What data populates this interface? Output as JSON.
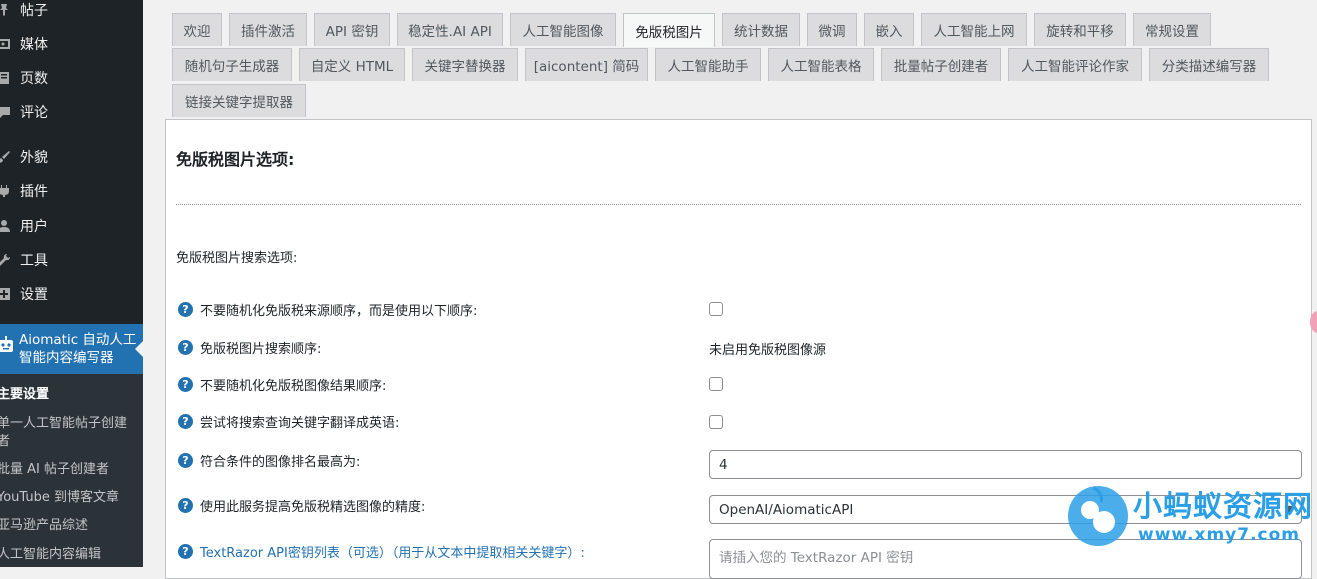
{
  "sidebar": {
    "items": [
      {
        "label": "帖子",
        "icon": "pin-icon"
      },
      {
        "label": "媒体",
        "icon": "media-icon"
      },
      {
        "label": "页数",
        "icon": "page-icon"
      },
      {
        "label": "评论",
        "icon": "comment-icon"
      },
      {
        "label": "外貌",
        "icon": "brush-icon"
      },
      {
        "label": "插件",
        "icon": "plugin-icon"
      },
      {
        "label": "用户",
        "icon": "user-icon"
      },
      {
        "label": "工具",
        "icon": "wrench-icon"
      },
      {
        "label": "设置",
        "icon": "settings-icon"
      }
    ],
    "active_plugin": {
      "label": "Aiomatic 自动人工智能内容编写器",
      "icon": "robot-icon"
    },
    "submenu": [
      {
        "label": "主要设置",
        "current": true
      },
      {
        "label": "单一人工智能帖子创建者"
      },
      {
        "label": "批量 AI 帖子创建者"
      },
      {
        "label": "YouTube 到博客文章"
      },
      {
        "label": "亚马逊产品综述"
      },
      {
        "label": "人工智能内容编辑"
      }
    ]
  },
  "tabs": [
    {
      "label": "欢迎"
    },
    {
      "label": "插件激活"
    },
    {
      "label": "API 密钥"
    },
    {
      "label": "稳定性.AI API"
    },
    {
      "label": "人工智能图像"
    },
    {
      "label": "免版税图片",
      "active": true
    },
    {
      "label": "统计数据"
    },
    {
      "label": "微调"
    },
    {
      "label": "嵌入"
    },
    {
      "label": "人工智能上网"
    },
    {
      "label": "旋转和平移"
    },
    {
      "label": "常规设置"
    },
    {
      "label": "随机句子生成器"
    },
    {
      "label": "自定义 HTML"
    },
    {
      "label": "关键字替换器"
    },
    {
      "label": "[aicontent] 简码"
    },
    {
      "label": "人工智能助手"
    },
    {
      "label": "人工智能表格"
    },
    {
      "label": "批量帖子创建者"
    },
    {
      "label": "人工智能评论作家"
    },
    {
      "label": "分类描述编写器"
    },
    {
      "label": "链接关键字提取器"
    }
  ],
  "panel": {
    "title": "免版税图片选项:",
    "section_label": "免版税图片搜索选项:",
    "rows": [
      {
        "label": "不要随机化免版税来源顺序，而是使用以下顺序:",
        "type": "checkbox",
        "checked": false
      },
      {
        "label": "免版税图片搜索顺序:",
        "type": "static",
        "value": "未启用免版税图像源"
      },
      {
        "label": "不要随机化免版税图像结果顺序:",
        "type": "checkbox",
        "checked": false
      },
      {
        "label": "尝试将搜索查询关键字翻译成英语:",
        "type": "checkbox",
        "checked": false
      },
      {
        "label": "符合条件的图像排名最高为:",
        "type": "input",
        "value": "4"
      },
      {
        "label": "使用此服务提高免版税精选图像的精度:",
        "type": "select",
        "value": "OpenAI/AiomaticAPI"
      },
      {
        "label": "TextRazor API密钥列表（可选）（用于从文本中提取相关关键字）:",
        "type": "textarea",
        "placeholder": "请插入您的 TextRazor API 密钥"
      }
    ]
  },
  "watermark": {
    "title": "小蚂蚁资源网",
    "url": "www.xmy7.com"
  },
  "colors": {
    "sidebar_bg": "#1d2327",
    "accent": "#2271b1",
    "watermark": "#2b9fe6"
  }
}
